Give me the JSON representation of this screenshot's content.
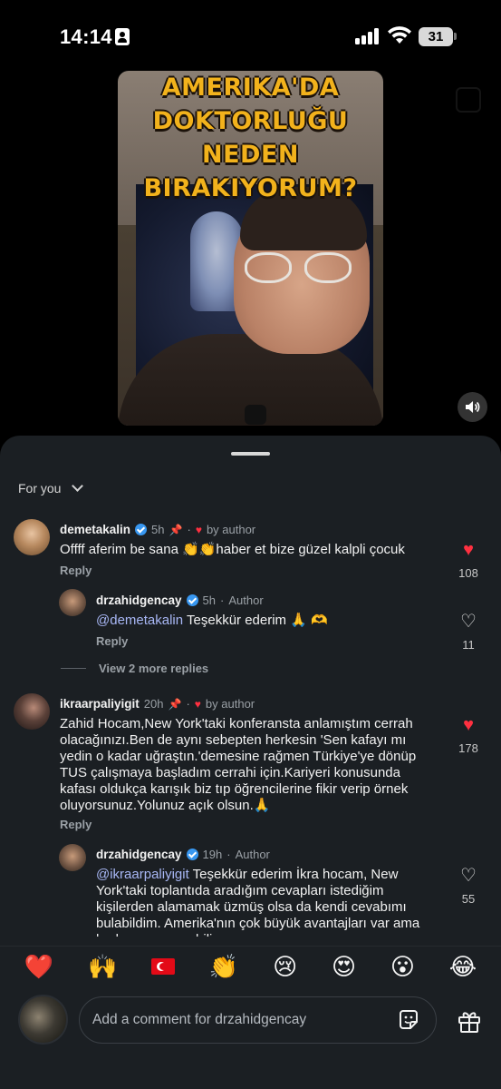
{
  "status_bar": {
    "time": "14:14",
    "battery": "31"
  },
  "video": {
    "title_lines": [
      "AMERIKA'DA",
      "DOKTORLUĞU",
      "NEDEN",
      "BIRAKIYORUM?"
    ]
  },
  "sheet": {
    "filter_label": "For you"
  },
  "comments": [
    {
      "username": "demetakalin",
      "time": "5h",
      "liked_by": "by author",
      "text": "Offff aferim be sana 👏👏haber et bize güzel kalpli çocuk",
      "reply_label": "Reply",
      "likes": "108"
    },
    {
      "username": "drzahidgencay",
      "time": "5h",
      "role": "Author",
      "mention": "@demetakalin",
      "text": " Teşekkür ederim 🙏 🫶",
      "reply_label": "Reply",
      "likes": "11"
    },
    {
      "username": "ikraarpaliyigit",
      "time": "20h",
      "liked_by": "by author",
      "text": "Zahid Hocam,New York'taki konferansta anlamıştım cerrah olacağınızı.Ben de aynı sebepten herkesin 'Sen kafayı mı yedin o kadar uğraştın.'demesine rağmen Türkiye'ye dönüp TUS çalışmaya başladım cerrahi için.Kariyeri konusunda kafası oldukça karışık biz tıp öğrencilerine fikir verip örnek oluyorsunuz.Yolunuz açık olsun.🙏",
      "reply_label": "Reply",
      "likes": "178"
    },
    {
      "username": "drzahidgencay",
      "time": "19h",
      "role": "Author",
      "mention": "@ikraarpaliyigit",
      "text": " Teşekkür ederim İkra hocam, New York'taki toplantıda aradığım cevapları istediğim kişilerden alamamak üzmüş olsa da kendi cevabımı bulabildim. Amerika'nın çok büyük avantajları var ama herkese uymayabilir",
      "likes": "55"
    }
  ],
  "view_more_replies": "View 2 more replies",
  "emoji_bar": [
    "❤️",
    "🙌",
    "flag-turkey",
    "👏",
    "😢",
    "😍",
    "😮",
    "😂"
  ],
  "composer": {
    "placeholder": "Add a comment for drzahidgencay"
  },
  "colors": {
    "like_red": "#ff3040",
    "mention": "#a8b7f5",
    "sheet_bg": "#1b1f23",
    "verified": "#3897f0"
  }
}
